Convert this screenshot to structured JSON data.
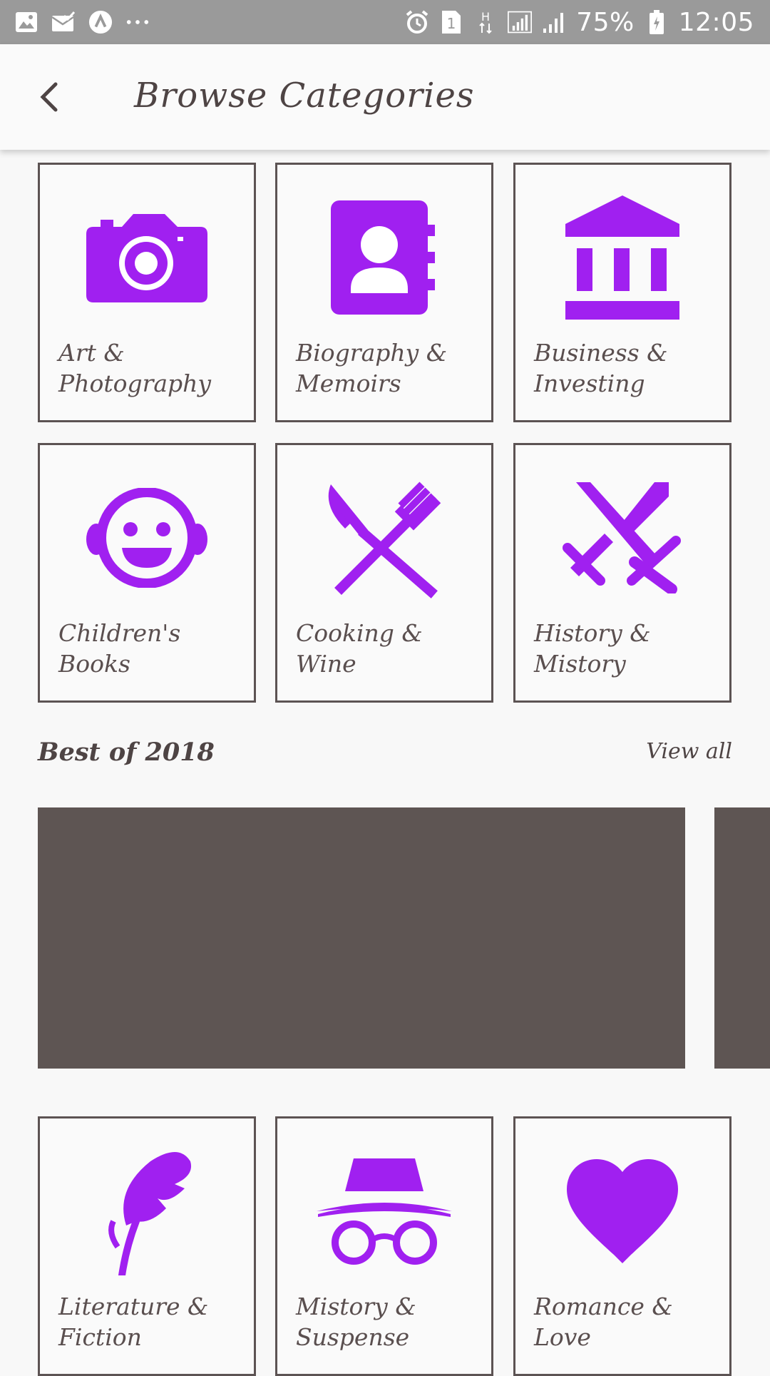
{
  "status_bar": {
    "battery": "75%",
    "time": "12:05",
    "sim_slot": "1",
    "network": "H",
    "left_icons": [
      "image-icon",
      "mail-check-icon",
      "app-icon",
      "more-dots-icon"
    ],
    "right_icons": [
      "alarm-icon",
      "sim-icon",
      "network-h-icon",
      "signal-icon",
      "signal-icon-2",
      "battery-icon"
    ]
  },
  "app_bar": {
    "title": "Browse Categories",
    "back_icon": "back-arrow-icon"
  },
  "colors": {
    "accent": "#a020f0",
    "border": "#5c5353",
    "text": "#5a4f4f",
    "banner": "#5e5553",
    "status_bar": "#9a9a9a"
  },
  "categories_top": [
    {
      "label": "Art &\nPhotography",
      "icon": "camera-icon"
    },
    {
      "label": "Biography &\nMemoirs",
      "icon": "contact-book-icon"
    },
    {
      "label": "Business &\nInvesting",
      "icon": "bank-icon"
    },
    {
      "label": "Children's\nBooks",
      "icon": "baby-face-icon"
    },
    {
      "label": "Cooking & Wine",
      "icon": "knife-fork-icon"
    },
    {
      "label": "History &\nMistory",
      "icon": "crossed-swords-icon"
    }
  ],
  "section": {
    "title": "Best of 2018",
    "view_all": "View all"
  },
  "categories_bottom": [
    {
      "label": "Literature &\nFiction",
      "icon": "feather-icon"
    },
    {
      "label": "Mistory &\nSuspense",
      "icon": "incognito-icon"
    },
    {
      "label": "Romance &\nLove",
      "icon": "heart-icon"
    }
  ]
}
